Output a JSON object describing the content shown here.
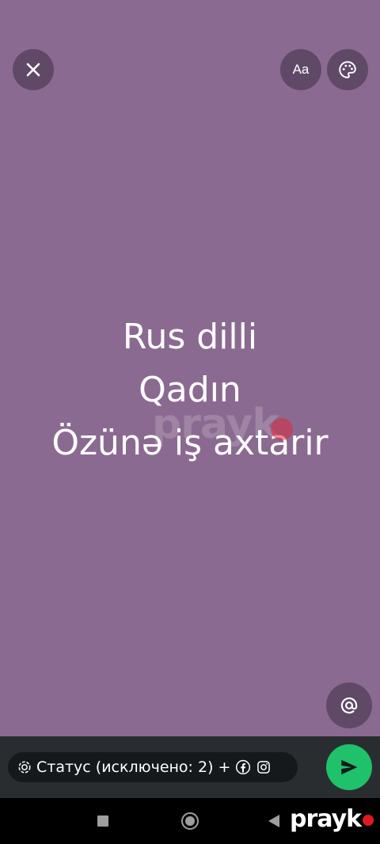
{
  "editor": {
    "background_color": "#8b6a91",
    "font_button_label": "Aa",
    "status_lines": [
      "Rus dilli",
      "Qadın",
      "Özünə iş axtarir"
    ]
  },
  "watermark": {
    "text": "prayk"
  },
  "composer": {
    "audience_label": "Статус (исключено: 2) +",
    "send_color": "#1fc16b"
  },
  "icons": {
    "close": "close-icon",
    "font": "text-style-icon",
    "palette": "palette-icon",
    "mention": "at-sign-icon",
    "privacy": "status-privacy-icon",
    "facebook": "facebook-icon",
    "instagram": "instagram-icon",
    "send": "send-icon"
  },
  "brand": {
    "text": "prayk"
  }
}
